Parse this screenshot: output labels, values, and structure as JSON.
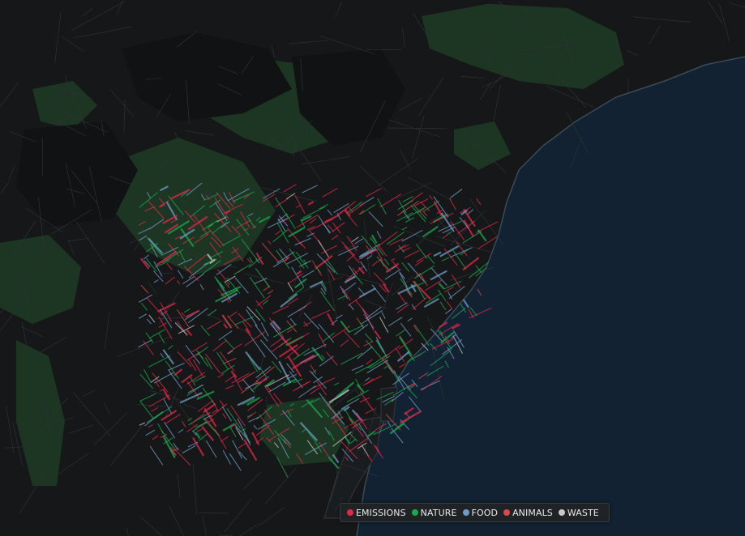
{
  "map": {
    "land_color": "#151718",
    "sea_color": "#122232",
    "park_color": "#1f3a26",
    "road_color": "#2c3033",
    "coast_color": "#3a4a58"
  },
  "legend": {
    "items": [
      {
        "id": "emissions",
        "label": "EMISSIONS",
        "color": "#e0284a",
        "icon": "emissions-dot"
      },
      {
        "id": "nature",
        "label": "NATURE",
        "color": "#1aa84c",
        "icon": "nature-dot"
      },
      {
        "id": "food",
        "label": "FOOD",
        "color": "#6f9cc4",
        "icon": "food-dot"
      },
      {
        "id": "animals",
        "label": "ANIMALS",
        "color": "#d94a4a",
        "icon": "animals-dot"
      },
      {
        "id": "waste",
        "label": "WASTE",
        "color": "#c8c8c8",
        "icon": "waste-dot"
      }
    ]
  }
}
